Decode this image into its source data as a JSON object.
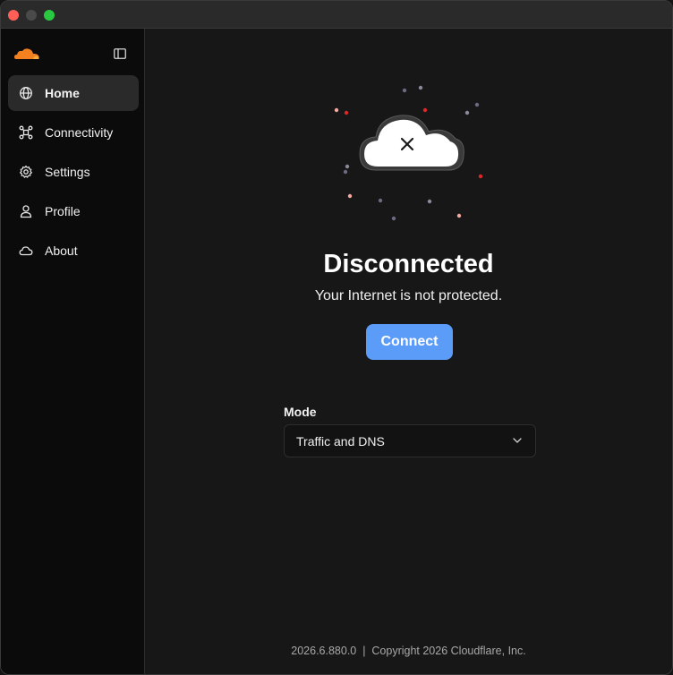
{
  "window": {
    "traffic_lights": [
      "close",
      "minimize",
      "maximize"
    ]
  },
  "sidebar": {
    "logo_icon": "cloudflare-logo-icon",
    "toggle_icon": "sidebar-toggle-icon",
    "items": [
      {
        "label": "Home",
        "icon": "globe-icon",
        "active": true
      },
      {
        "label": "Connectivity",
        "icon": "network-icon",
        "active": false
      },
      {
        "label": "Settings",
        "icon": "gear-icon",
        "active": false
      },
      {
        "label": "Profile",
        "icon": "user-icon",
        "active": false
      },
      {
        "label": "About",
        "icon": "cloud-icon",
        "active": false
      }
    ]
  },
  "main": {
    "status_icon": "cloud-x-icon",
    "title": "Disconnected",
    "subtitle": "Your Internet is not protected.",
    "connect_label": "Connect",
    "mode_label": "Mode",
    "mode_value": "Traffic and DNS",
    "footer": "2026.6.880.0  |  Copyright 2026 Cloudflare, Inc."
  },
  "colors": {
    "accent": "#5b9cf8",
    "sidebar_bg": "#0b0b0b",
    "main_bg": "#171717",
    "logo_orange": "#f48120"
  }
}
